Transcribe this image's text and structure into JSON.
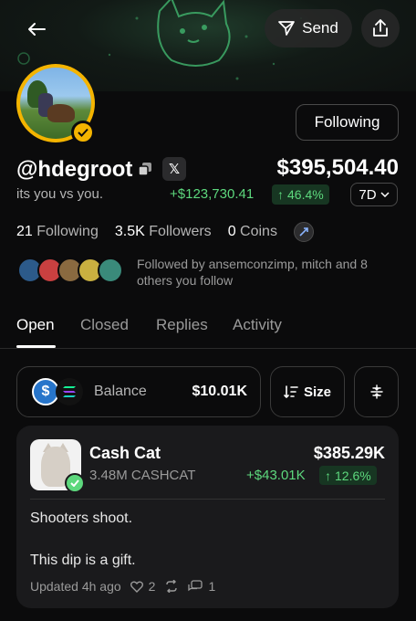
{
  "header": {
    "send_label": "Send"
  },
  "profile": {
    "handle": "@hdegroot",
    "bio": "its you vs you.",
    "total_value": "$395,504.40",
    "gain": "+$123,730.41",
    "gain_pct": "46.4%",
    "range": "7D",
    "following_button": "Following",
    "x_icon_label": "𝕏"
  },
  "stats": {
    "following_count": "21",
    "following_label": "Following",
    "followers_count": "3.5K",
    "followers_label": "Followers",
    "coins_count": "0",
    "coins_label": "Coins"
  },
  "followed_by": "Followed by ansemconzimp, mitch and 8 others you follow",
  "tabs": [
    {
      "label": "Open"
    },
    {
      "label": "Closed"
    },
    {
      "label": "Replies"
    },
    {
      "label": "Activity"
    }
  ],
  "balance_card": {
    "label": "Balance",
    "value": "$10.01K"
  },
  "sort_button": {
    "label": "Size"
  },
  "position": {
    "name": "Cash Cat",
    "amount": "3.48M CASHCAT",
    "value": "$385.29K",
    "gain": "+$43.01K",
    "gain_pct": "12.6%",
    "note_line1": "Shooters shoot.",
    "note_line2": "This dip is a gift.",
    "updated": "Updated 4h ago",
    "likes": "2",
    "comments": "1"
  },
  "colors": {
    "gain_green": "#5dd87d",
    "avatar_ring": "#f4b400",
    "usdc_blue": "#2775ca"
  },
  "icons": [
    "back-arrow-icon",
    "send-icon",
    "share-icon",
    "verified-badge-icon",
    "copy-icon",
    "x-logo-icon",
    "chevron-down-icon",
    "chain-icon",
    "usdc-icon",
    "solana-icon",
    "sort-icon",
    "filter-icon",
    "heart-icon",
    "repost-icon",
    "comment-icon"
  ]
}
